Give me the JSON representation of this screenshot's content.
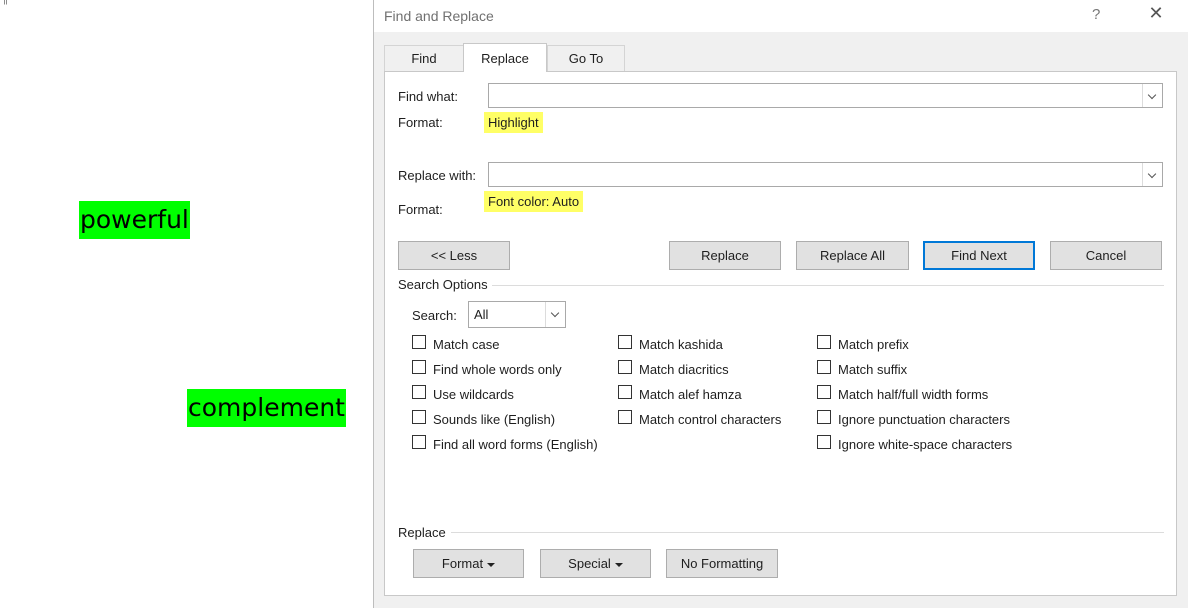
{
  "document": {
    "mark": "¶",
    "words": [
      "powerful",
      "complement"
    ]
  },
  "dialog": {
    "title": "Find and Replace",
    "help": "?",
    "close": "✕",
    "tabs": [
      "Find",
      "Replace",
      "Go To"
    ],
    "active_tab": "Replace",
    "find_label": "Find what:",
    "find_value": "",
    "find_format_label": "Format:",
    "find_format": "Highlight",
    "replace_label": "Replace with:",
    "replace_value": "",
    "replace_format_label": "Format:",
    "replace_format": "Font color: Auto",
    "buttons": {
      "less": "<< Less",
      "replace": "Replace",
      "replace_all": "Replace All",
      "find_next": "Find Next",
      "cancel": "Cancel"
    },
    "search_options": {
      "title": "Search Options",
      "search_label": "Search:",
      "search_value": "All",
      "col1": [
        "Match case",
        "Find whole words only",
        "Use wildcards",
        "Sounds like (English)",
        "Find all word forms (English)"
      ],
      "col2": [
        "Match kashida",
        "Match diacritics",
        "Match alef hamza",
        "Match control characters"
      ],
      "col3": [
        "Match prefix",
        "Match suffix",
        "Match half/full width forms",
        "Ignore punctuation characters",
        "Ignore white-space characters"
      ]
    },
    "replace_section": {
      "title": "Replace",
      "format": "Format",
      "special": "Special",
      "no_formatting": "No Formatting"
    }
  },
  "colors": {
    "highlight_green": "#00ff00",
    "format_yellow": "#ffff66",
    "default_button_border": "#0078d7"
  }
}
